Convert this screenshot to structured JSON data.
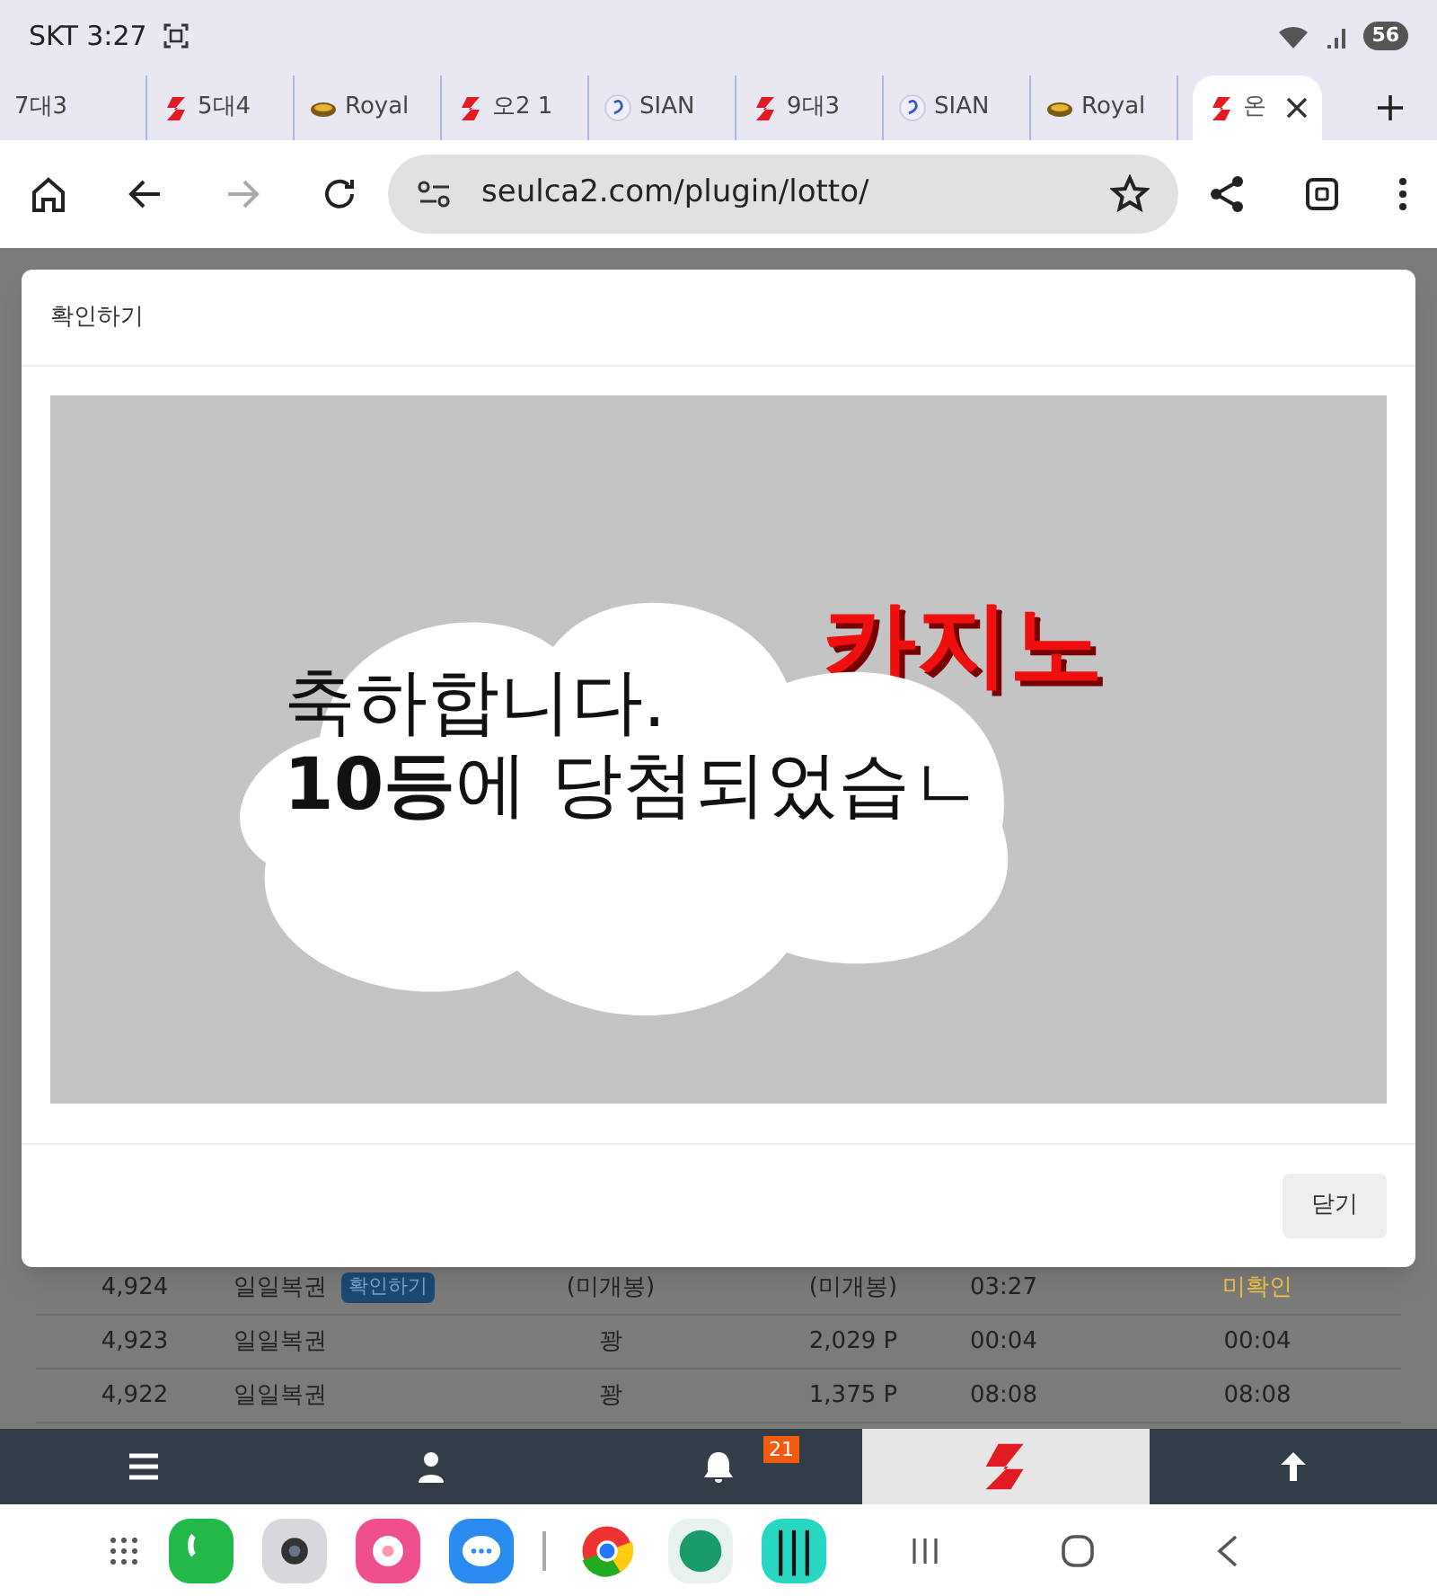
{
  "status_bar": {
    "carrier_time": "SKT 3:27",
    "battery": "56"
  },
  "tabs": [
    {
      "label": "7대3",
      "kind": "plain",
      "selected": false
    },
    {
      "label": "5대4",
      "kind": "bolt",
      "selected": false
    },
    {
      "label": "Royal",
      "kind": "emblem",
      "selected": false
    },
    {
      "label": "오2 1",
      "kind": "bolt",
      "selected": false
    },
    {
      "label": "SIAN",
      "kind": "circle",
      "selected": false
    },
    {
      "label": "9대3",
      "kind": "bolt",
      "selected": false
    },
    {
      "label": "SIAN",
      "kind": "circle",
      "selected": false
    },
    {
      "label": "Royal",
      "kind": "emblem",
      "selected": false
    },
    {
      "label": "온",
      "kind": "bolt",
      "selected": true
    }
  ],
  "address_bar": {
    "url": "seulca2.com/plugin/lotto/"
  },
  "modal": {
    "title": "확인하기",
    "banner_text": "카지노",
    "message_lines": [
      "축하합니다.",
      "**10등**에 당첨되었습ㄴ"
    ],
    "close_button": "닫기"
  },
  "table": {
    "rows": [
      {
        "cells": [
          "4,924",
          "일일복권",
          "(미개봉)",
          "(미개봉)",
          "03:27",
          "미확인"
        ],
        "badge": "확인하기",
        "kind": "pending"
      },
      {
        "cells": [
          "4,923",
          "일일복권",
          "꽝",
          "2,029 P",
          "00:04",
          "00:04"
        ],
        "kind": "done"
      },
      {
        "cells": [
          "4,922",
          "일일복권",
          "꽝",
          "1,375 P",
          "08:08",
          "08:08"
        ],
        "kind": "done"
      }
    ]
  },
  "bottom_nav": [
    {
      "kind": "menu",
      "selected": false
    },
    {
      "kind": "user",
      "selected": false
    },
    {
      "kind": "bell",
      "badge": "21",
      "selected": false
    },
    {
      "kind": "logo",
      "selected": true
    },
    {
      "kind": "top",
      "selected": false
    }
  ]
}
